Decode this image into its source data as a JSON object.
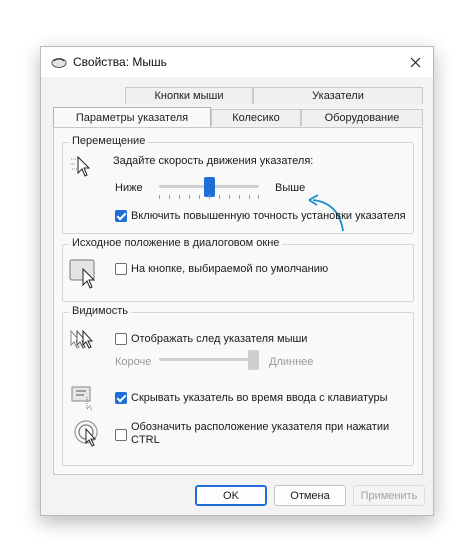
{
  "window": {
    "title": "Свойства: Мышь"
  },
  "tabs_top": [
    {
      "label": "Кнопки мыши"
    },
    {
      "label": "Указатели"
    }
  ],
  "tabs_bottom": [
    {
      "label": "Параметры указателя"
    },
    {
      "label": "Колесико"
    },
    {
      "label": "Оборудование"
    }
  ],
  "motion": {
    "title": "Перемещение",
    "speed_label": "Задайте скорость движения указателя:",
    "slow_label": "Ниже",
    "fast_label": "Выше",
    "speed_value": 0.5,
    "precision_label": "Включить повышенную точность установки указателя",
    "precision_checked": true
  },
  "snap": {
    "title": "Исходное положение в диалоговом окне",
    "snap_label": "На кнопке, выбираемой по умолчанию",
    "snap_checked": false
  },
  "visibility": {
    "title": "Видимость",
    "trails_label": "Отображать след указателя мыши",
    "trails_checked": false,
    "short_label": "Короче",
    "long_label": "Длиннее",
    "trails_value": 1.0,
    "hide_label": "Скрывать указатель во время ввода с клавиатуры",
    "hide_checked": true,
    "ctrl_label_line1": "Обозначить расположение указателя при нажатии",
    "ctrl_label_line2": "CTRL",
    "ctrl_checked": false
  },
  "buttons": {
    "ok": "OK",
    "cancel": "Отмена",
    "apply": "Применить"
  },
  "colors": {
    "accent": "#1e6ed6",
    "arrow": "#1a8fd0"
  }
}
